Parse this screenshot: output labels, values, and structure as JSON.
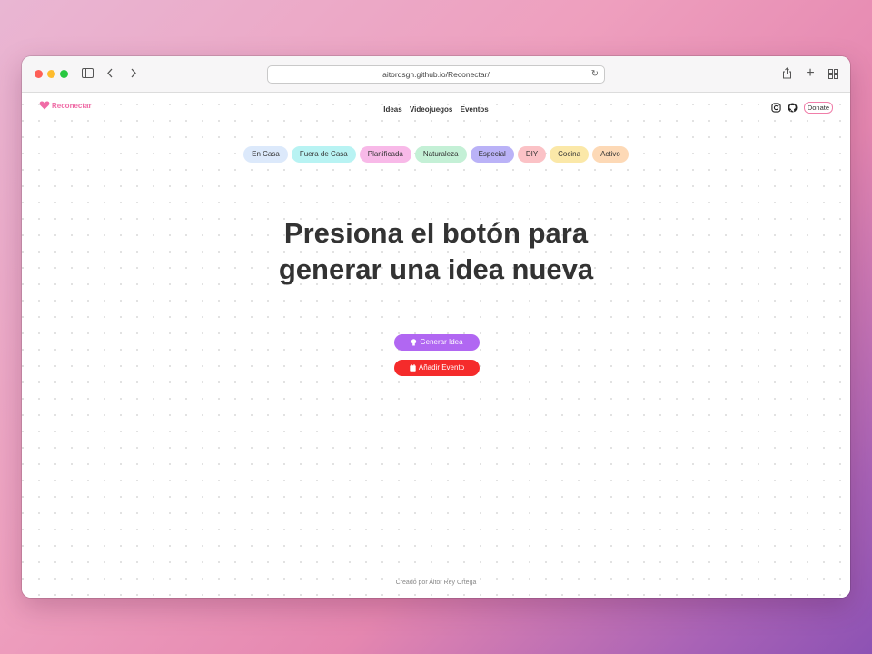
{
  "browser": {
    "url": "aitordsgn.github.io/Reconectar/"
  },
  "site": {
    "logo_text": "Reconectar",
    "brand_color": "#f06ba6",
    "nav": [
      "Ideas",
      "Videojuegos",
      "Eventos"
    ],
    "donate_label": "Donate"
  },
  "categories": [
    {
      "label": "En Casa",
      "color": "#dce9fb"
    },
    {
      "label": "Fuera de Casa",
      "color": "#b8f3f3"
    },
    {
      "label": "Planificada",
      "color": "#f8b9e8"
    },
    {
      "label": "Naturaleza",
      "color": "#c4f0d6"
    },
    {
      "label": "Especial",
      "color": "#bab2f7"
    },
    {
      "label": "DIY",
      "color": "#fbc2c6"
    },
    {
      "label": "Cocina",
      "color": "#fbe8a8"
    },
    {
      "label": "Activo",
      "color": "#fdd9b6"
    }
  ],
  "main": {
    "headline_line1": "Presiona el botón para",
    "headline_line2": "generar una idea nueva",
    "generate_label": "Generar Idea",
    "generate_color": "#b167f2",
    "add_event_label": "Añadir Evento",
    "add_event_color": "#f52b2b"
  },
  "footer": {
    "credit": "Creado por Aitor Rey Ortega"
  }
}
